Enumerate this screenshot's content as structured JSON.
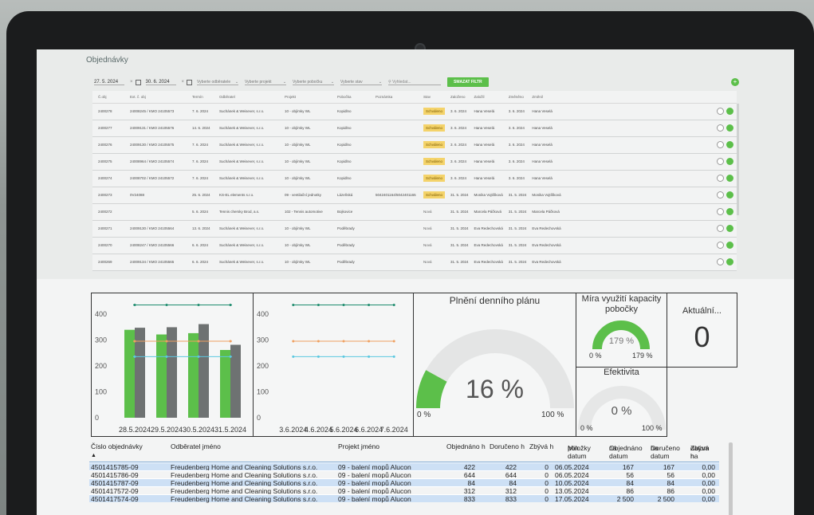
{
  "app": {
    "title": "Objednávky",
    "filters": {
      "date_from": "27. 5. 2024",
      "date_to": "30. 6. 2024",
      "customer_placeholder": "Vyberte odběratele",
      "project_placeholder": "Vyberte projekt",
      "branch_placeholder": "Vyberte pobočku",
      "state_placeholder": "Vyberte stav",
      "search_placeholder": "Vyhledat...",
      "clear_button": "SMAZAT FILTR"
    },
    "add_button": "+",
    "columns": [
      "Č.obj",
      "Ext. č. obj",
      "Termín",
      "Odběratel",
      "Projekt",
      "Pobočka",
      "Poznámka",
      "Stav",
      "Založeno",
      "Založil",
      "Změněno",
      "Změnil"
    ],
    "rows": [
      [
        "2400278",
        "24008245 / KMO 24105573",
        "7. 6. 2024",
        "Suchánek & Weisever, s.r.o.",
        "10 - objímky WL",
        "Kopidlno",
        "",
        "Schváleno",
        "3. 6. 2024",
        "Hana Veselá",
        "3. 6. 2024",
        "Hana Veselá"
      ],
      [
        "2400277",
        "24009131 / KMO 24105576",
        "14. 6. 2024",
        "Suchánek & Weisever, s.r.o.",
        "10 - objímky WL",
        "Kopidlno",
        "",
        "Schváleno",
        "3. 6. 2024",
        "Hana Veselá",
        "3. 6. 2024",
        "Hana Veselá"
      ],
      [
        "2400276",
        "24009130 / KMO 24105575",
        "7. 6. 2024",
        "Suchánek & Weisever, s.r.o.",
        "10 - objímky WL",
        "Kopidlno",
        "",
        "Schváleno",
        "3. 6. 2024",
        "Hana Veselá",
        "3. 6. 2024",
        "Hana Veselá"
      ],
      [
        "2400275",
        "24008964 / KMO 24105574",
        "7. 6. 2024",
        "Suchánek & Weisever, s.r.o.",
        "10 - objímky WL",
        "Kopidlno",
        "",
        "Schváleno",
        "3. 6. 2024",
        "Hana Veselá",
        "3. 6. 2024",
        "Hana Veselá"
      ],
      [
        "2400274",
        "24008702 / KMO 24105572",
        "7. 6. 2024",
        "Suchánek & Weisever, s.r.o.",
        "10 - objímky WL",
        "Kopidlno",
        "",
        "Schváleno",
        "3. 6. 2024",
        "Hana Veselá",
        "3. 6. 2024",
        "Hana Veselá"
      ],
      [
        "2400273",
        "0V24088",
        "25. 6. 2024",
        "KS-EL elements s.r.o.",
        "09 - ventilační jednotky",
        "Lázeňská",
        "5042401164/5042401165",
        "Schváleno",
        "31. 5. 2024",
        "Monika Vojtíšková",
        "31. 5. 2024",
        "Monika Vojtíšková"
      ],
      [
        "2400272",
        "",
        "5. 6. 2024",
        "Tennis chersky Brod, a.s.",
        "102 - Tennis automotive",
        "Bojkovice",
        "",
        "Nová",
        "31. 5. 2024",
        "Marcela Páčková",
        "31. 5. 2024",
        "Marcela Páčková"
      ],
      [
        "2400271",
        "24009130 / KMO 24105564",
        "13. 6. 2024",
        "Suchánek & Weisever, s.r.o.",
        "10 - objímky WL",
        "Poděbrady",
        "",
        "Nová",
        "31. 5. 2024",
        "Eva Redechovská",
        "31. 5. 2024",
        "Eva Redechovská"
      ],
      [
        "2400270",
        "24008247 / KMO 24105566",
        "6. 6. 2024",
        "Suchánek & Weisever, s.r.o.",
        "10 - objímky WL",
        "Poděbrady",
        "",
        "Nová",
        "31. 5. 2024",
        "Eva Redechovská",
        "31. 5. 2024",
        "Eva Redechovská"
      ],
      [
        "2400269",
        "24009134 / KMO 24105565",
        "6. 6. 2024",
        "Suchánek & Weisever, s.r.o.",
        "10 - objímky WL",
        "Poděbrady",
        "",
        "Nová",
        "31. 5. 2024",
        "Eva Redechovská",
        "31. 5. 2024",
        "Eva Redechovská"
      ]
    ]
  },
  "chart_data": [
    {
      "type": "bar",
      "categories": [
        "28.5.2024",
        "29.5.2024",
        "30.5.2024",
        "31.5.2024"
      ],
      "series": [
        {
          "values": [
            340,
            322,
            327,
            262
          ]
        },
        {
          "values": [
            348,
            350,
            362,
            282
          ]
        }
      ],
      "reference_lines": [
        {
          "value": 436,
          "color": "#1e8c6e"
        },
        {
          "value": 296,
          "color": "#f0a060"
        },
        {
          "value": 236,
          "color": "#5bc8e0"
        }
      ],
      "ylim": [
        0,
        450
      ],
      "yticks": [
        0,
        100,
        200,
        300,
        400
      ]
    },
    {
      "type": "line",
      "categories": [
        "3.6.2024",
        "4.6.2024",
        "5.6.2024",
        "6.6.2024",
        "7.6.2024"
      ],
      "series": [
        {
          "values": [
            436,
            436,
            436,
            436,
            436
          ],
          "color": "#1e8c6e"
        },
        {
          "values": [
            296,
            296,
            296,
            296,
            296
          ],
          "color": "#f0a060"
        },
        {
          "values": [
            236,
            236,
            236,
            236,
            236
          ],
          "color": "#5bc8e0"
        }
      ],
      "ylim": [
        0,
        450
      ],
      "yticks": [
        0,
        100,
        200,
        300,
        400
      ]
    }
  ],
  "gauges": {
    "plan": {
      "title": "Plnění denního plánu",
      "value_label": "16 %",
      "min_label": "0 %",
      "max_label": "100 %",
      "value": 16
    },
    "capacity": {
      "title_line1": "Míra využití kapacity",
      "title_line2": "pobočky",
      "value_label": "179 %",
      "min_label": "0 %",
      "max_label": "179 %",
      "value": 179,
      "max": 179
    },
    "current": {
      "title": "Aktuální...",
      "value": "0"
    },
    "efficiency": {
      "title": "Efektivita",
      "value_label": "0 %",
      "min_label": "0 %",
      "max_label": "100 %",
      "value": 0
    }
  },
  "bottom_table": {
    "headers": {
      "order": "Číslo objednávky",
      "customer": "Odběratel jméno",
      "project": "Projekt jméno",
      "ordered": "Objednáno h",
      "delivered": "Doručeno h",
      "remaining": "Zbývá h",
      "min_date_1": "Min datum",
      "min_date_2": "položky",
      "ordered_to_1": "Objednáno",
      "ordered_to_2": "na datum h",
      "delivered_to_1": "Doručeno",
      "delivered_to_2": "na datum h",
      "remaining_to_1": "Zbývá na",
      "remaining_to_2": "datum h"
    },
    "rows": [
      {
        "order": "4501415785-09",
        "customer": "Freudenberg Home and Cleaning Solutions s.r.o.",
        "project": "09 - balení mopů Alucon",
        "ordered": "422",
        "delivered": "422",
        "remaining": "0",
        "min_date": "06.05.2024",
        "ordered_to": "167",
        "delivered_to": "167",
        "remaining_to": "0,00"
      },
      {
        "order": "4501415786-09",
        "customer": "Freudenberg Home and Cleaning Solutions s.r.o.",
        "project": "09 - balení mopů Alucon",
        "ordered": "644",
        "delivered": "644",
        "remaining": "0",
        "min_date": "06.05.2024",
        "ordered_to": "56",
        "delivered_to": "56",
        "remaining_to": "0,00"
      },
      {
        "order": "4501415787-09",
        "customer": "Freudenberg Home and Cleaning Solutions s.r.o.",
        "project": "09 - balení mopů Alucon",
        "ordered": "84",
        "delivered": "84",
        "remaining": "0",
        "min_date": "10.05.2024",
        "ordered_to": "84",
        "delivered_to": "84",
        "remaining_to": "0,00"
      },
      {
        "order": "4501417572-09",
        "customer": "Freudenberg Home and Cleaning Solutions s.r.o.",
        "project": "09 - balení mopů Alucon",
        "ordered": "312",
        "delivered": "312",
        "remaining": "0",
        "min_date": "13.05.2024",
        "ordered_to": "86",
        "delivered_to": "86",
        "remaining_to": "0,00"
      },
      {
        "order": "4501417574-09",
        "customer": "Freudenberg Home and Cleaning Solutions s.r.o.",
        "project": "09 - balení mopů Alucon",
        "ordered": "833",
        "delivered": "833",
        "remaining": "0",
        "min_date": "17.05.2024",
        "ordered_to": "2 500",
        "delivered_to": "2 500",
        "remaining_to": "0,00"
      }
    ]
  },
  "colors": {
    "accent_green": "#5cbf4a",
    "bar_gray": "#6e7272",
    "approved_badge": "#f4d36a"
  }
}
